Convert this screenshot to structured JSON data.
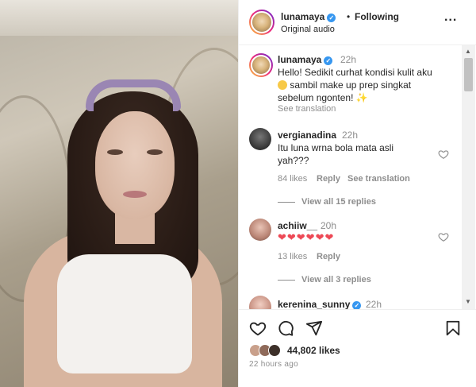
{
  "post": {
    "username": "lunamaya",
    "following_label": "Following",
    "separator": "•",
    "audio_label": "Original audio",
    "more_label": "..."
  },
  "caption": {
    "username": "lunamaya",
    "time": "22h",
    "text_line1": "Hello! Sedikit curhat kondisi kulit aku",
    "text_line2": " sambil make up prep singkat",
    "text_line3": "sebelum ngonten! ",
    "sparkle": "✨",
    "see_translation": "See translation"
  },
  "comments": [
    {
      "username": "vergianadina",
      "time": "22h",
      "line1": "Itu luna wrna bola mata asli",
      "line2": "yah???",
      "likes": "84 likes",
      "reply": "Reply",
      "see_translation": "See translation",
      "view_replies": "View all 15 replies"
    },
    {
      "username": "achiiw__",
      "time": "20h",
      "line1": "❤❤❤❤❤❤",
      "likes": "13 likes",
      "reply": "Reply",
      "view_replies": "View all 3 replies"
    },
    {
      "username": "kerenina_sunny",
      "time": "22h"
    }
  ],
  "footer": {
    "likes": "44,802 likes",
    "time_ago": "22 hours ago"
  },
  "colors": {
    "verified": "#3797f0",
    "heart_red": "#ed4956",
    "muted": "#8e8e8e"
  }
}
